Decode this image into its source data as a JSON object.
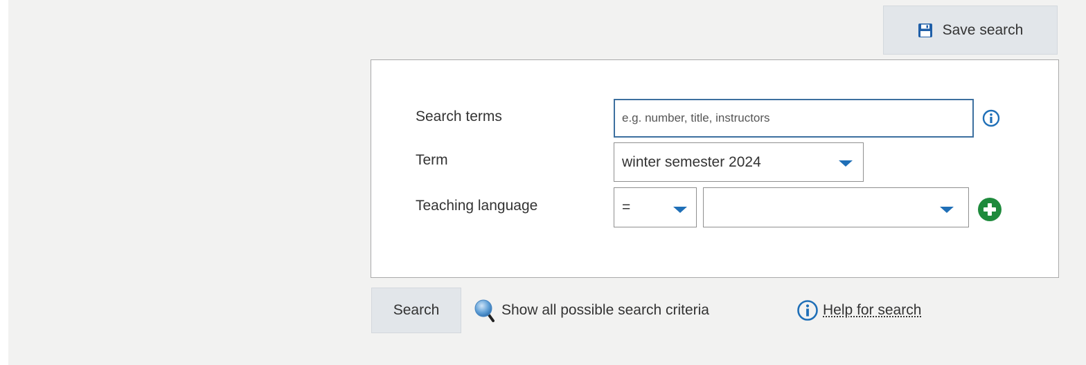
{
  "toolbar": {
    "save_search_label": "Save search"
  },
  "form": {
    "search_terms_label": "Search terms",
    "search_terms_value": "",
    "search_terms_placeholder": "e.g. number, title, instructors",
    "term_label": "Term",
    "term_value": "winter semester 2024",
    "teaching_language_label": "Teaching language",
    "operator_value": "=",
    "language_value": ""
  },
  "actions": {
    "search_label": "Search",
    "show_all_criteria_label": "Show all possible search criteria",
    "help_label": "Help for search"
  },
  "icons": {
    "save": "floppy-disk-icon",
    "info": "info-circle-icon",
    "add": "plus-circle-icon",
    "magnifier": "magnifier-icon",
    "dropdown": "chevron-down-icon"
  },
  "colors": {
    "accent_blue": "#1f6fb7",
    "add_green": "#1e8a3c",
    "button_bg": "#e2e6ea",
    "page_bg": "#f2f2f1"
  }
}
